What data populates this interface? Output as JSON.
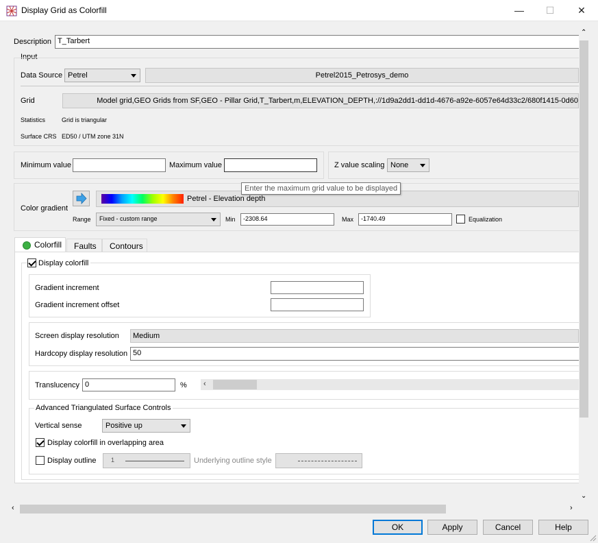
{
  "window": {
    "title": "Display Grid as Colorfill",
    "minimize": "—",
    "maximize": "☐",
    "close": "✕"
  },
  "description": {
    "label": "Description",
    "value": "T_Tarbert"
  },
  "input": {
    "group_label": "Input",
    "data_source_label": "Data Source",
    "data_source_value": "Petrel",
    "project_value": "Petrel2015_Petrosys_demo",
    "grid_label": "Grid",
    "grid_value": "Model grid,GEO Grids from SF,GEO - Pillar Grid,T_Tarbert,m,ELEVATION_DEPTH,://1d9a2dd1-dd1d-4676-a92e-6057e64d33c2/680f1415-0d60",
    "statistics_label": "Statistics",
    "statistics_value": "Grid is triangular",
    "surface_crs_label": "Surface CRS",
    "surface_crs_value": "ED50 / UTM zone 31N"
  },
  "range": {
    "min_label": "Minimum value",
    "min_value": "",
    "max_label": "Maximum value",
    "max_value": "",
    "tooltip": "Enter the maximum grid value to be displayed",
    "z_scaling_label": "Z value scaling",
    "z_scaling_value": "None"
  },
  "color_gradient": {
    "label": "Color gradient",
    "name": "Petrel - Elevation depth",
    "range_label": "Range",
    "range_value": "Fixed - custom range",
    "min_label": "Min",
    "min_value": "-2308.64",
    "max_label": "Max",
    "max_value": "-1740.49",
    "equalization_label": "Equalization"
  },
  "tabs": [
    {
      "label": "Colorfill"
    },
    {
      "label": "Faults"
    },
    {
      "label": "Contours"
    }
  ],
  "colorfill": {
    "display_colorfill_label": "Display colorfill",
    "gradient_increment_label": "Gradient increment",
    "gradient_increment_value": "",
    "gradient_offset_label": "Gradient increment offset",
    "gradient_offset_value": "",
    "screen_res_label": "Screen display resolution",
    "screen_res_value": "Medium",
    "hardcopy_res_label": "Hardcopy display resolution",
    "hardcopy_res_value": "50",
    "translucency_label": "Translucency",
    "translucency_value": "0",
    "translucency_unit": "%",
    "advanced_label": "Advanced Triangulated Surface Controls",
    "vertical_sense_label": "Vertical sense",
    "vertical_sense_value": "Positive up",
    "overlap_label": "Display colorfill in overlapping area",
    "outline_label": "Display outline",
    "outline_width": "1",
    "underlying_style_label": "Underlying outline style"
  },
  "buttons": {
    "ok": "OK",
    "apply": "Apply",
    "cancel": "Cancel",
    "help": "Help"
  },
  "colors": {
    "accent": "#0078d7",
    "tab_dot": "#3cb043"
  }
}
